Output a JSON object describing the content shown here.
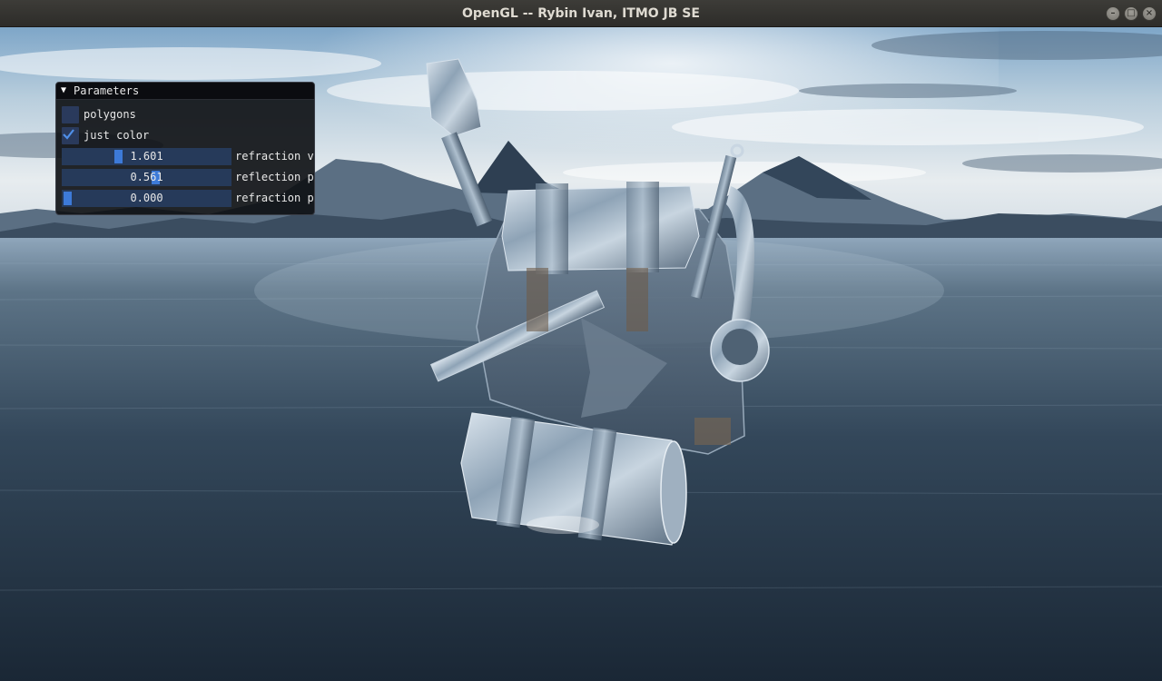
{
  "window": {
    "title": "OpenGL -- Rybin Ivan, ITMO JB SE",
    "buttons": [
      "minimize-icon",
      "maximize-icon",
      "close-icon"
    ]
  },
  "scene": {
    "description_icons": [
      "skybox-mountains-lake",
      "metallic-backpack-model"
    ]
  },
  "panel": {
    "title": "Parameters",
    "collapse_icon": "triangle-down-icon",
    "checkboxes": [
      {
        "label": "polygons",
        "checked": false
      },
      {
        "label": "just color",
        "checked": true
      }
    ],
    "sliders": [
      {
        "value": "1.601",
        "label": "refraction v",
        "fraction": 0.32
      },
      {
        "value": "0.561",
        "label": "reflection p",
        "fraction": 0.56
      },
      {
        "value": "0.000",
        "label": "refraction p",
        "fraction": 0.0
      }
    ]
  },
  "colors": {
    "titlebar": "#353430",
    "panel_bg": "#0c0e12",
    "frame_bg": "#263a5a",
    "accent": "#3d7ad8"
  }
}
